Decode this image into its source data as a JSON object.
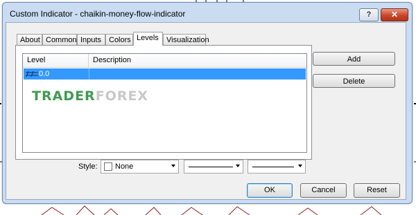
{
  "window": {
    "title": "Custom Indicator - chaikin-money-flow-indicator",
    "help_label": "?",
    "close_label": "✕"
  },
  "tabs": [
    {
      "label": "About",
      "active": false
    },
    {
      "label": "Common",
      "active": false
    },
    {
      "label": "Inputs",
      "active": false
    },
    {
      "label": "Colors",
      "active": false
    },
    {
      "label": "Levels",
      "active": true
    },
    {
      "label": "Visualization",
      "active": false
    }
  ],
  "levels_table": {
    "columns": [
      "Level",
      "Description"
    ],
    "rows": [
      {
        "level": "0.0",
        "description": "",
        "selected": true
      }
    ]
  },
  "watermark": {
    "part1": "TRADER",
    "part2": "FOREX"
  },
  "side_buttons": {
    "add": "Add",
    "delete": "Delete"
  },
  "style": {
    "label": "Style:",
    "color_value": "None"
  },
  "footer": {
    "ok": "OK",
    "cancel": "Cancel",
    "reset": "Reset"
  },
  "colors": {
    "selection": "#3399ff",
    "dialog_frame": "#c9dcf2",
    "watermark_green": "#3f9b4f"
  }
}
